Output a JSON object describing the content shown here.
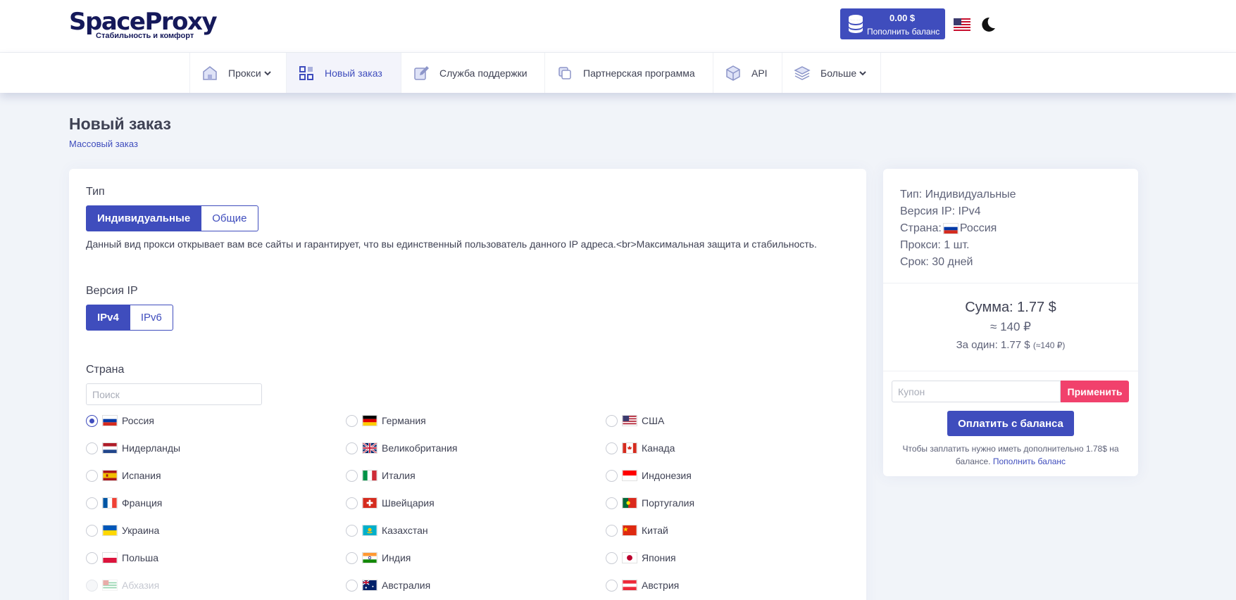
{
  "header": {
    "logo_text": "SpaceProxy",
    "logo_subtitle": "Стабильность и комфорт",
    "balance_amount": "0.00 $",
    "balance_label": "Пополнить баланс",
    "language_flag": "us-flag-icon",
    "theme_icon": "moon-icon"
  },
  "nav": {
    "items": [
      {
        "label": "Прокси",
        "icon": "home-icon",
        "dropdown": true
      },
      {
        "label": "Новый заказ",
        "icon": "grid-icon",
        "active": true
      },
      {
        "label": "Служба поддержки",
        "icon": "edit-icon"
      },
      {
        "label": "Партнерская программа",
        "icon": "copy-icon"
      },
      {
        "label": "API",
        "icon": "cube-icon"
      },
      {
        "label": "Больше",
        "icon": "layers-icon",
        "dropdown": true
      }
    ]
  },
  "page": {
    "title": "Новый заказ",
    "breadcrumb": "Массовый заказ"
  },
  "form": {
    "type_label": "Тип",
    "type_options": [
      "Индивидуальные",
      "Общие"
    ],
    "type_selected": "Индивидуальные",
    "type_description": "Данный вид прокси открывает вам все сайты и гарантирует, что вы единственный пользователь данного IP адреса.<br>Максимальная защита и стабильность.",
    "ip_label": "Версия IP",
    "ip_options": [
      "IPv4",
      "IPv6"
    ],
    "ip_selected": "IPv4",
    "country_label": "Страна",
    "search_placeholder": "Поиск",
    "countries": [
      {
        "name": "Россия",
        "selected": true
      },
      {
        "name": "Германия"
      },
      {
        "name": "США"
      },
      {
        "name": "Нидерланды"
      },
      {
        "name": "Великобритания"
      },
      {
        "name": "Канада"
      },
      {
        "name": "Испания"
      },
      {
        "name": "Италия"
      },
      {
        "name": "Индонезия"
      },
      {
        "name": "Франция"
      },
      {
        "name": "Швейцария"
      },
      {
        "name": "Португалия"
      },
      {
        "name": "Украина"
      },
      {
        "name": "Казахстан"
      },
      {
        "name": "Китай"
      },
      {
        "name": "Польша"
      },
      {
        "name": "Индия"
      },
      {
        "name": "Япония"
      },
      {
        "name": "Абхазия",
        "disabled": true
      },
      {
        "name": "Австралия"
      },
      {
        "name": "Австрия"
      }
    ]
  },
  "summary": {
    "type": "Тип: Индивидуальные",
    "ip": "Версия IP: IPv4",
    "country_prefix": "Страна:",
    "country_name": "Россия",
    "proxies": "Прокси: 1 шт.",
    "term": "Срок: 30 дней",
    "total": "Сумма: 1.77 $",
    "total_rub": "≈ 140 ₽",
    "per_one": "За один: 1.77 $",
    "per_one_rub": "(≈140 ₽)",
    "coupon_placeholder": "Купон",
    "apply_label": "Применить",
    "pay_label": "Оплатить с баланса",
    "pay_note": "Чтобы заплатить нужно иметь дополнительно 1.78$ на балансе.",
    "pay_note_link": "Пополнить баланс"
  },
  "colors": {
    "primary": "#3f4dbd",
    "danger": "#f1416c",
    "background": "#f1f4f9"
  }
}
